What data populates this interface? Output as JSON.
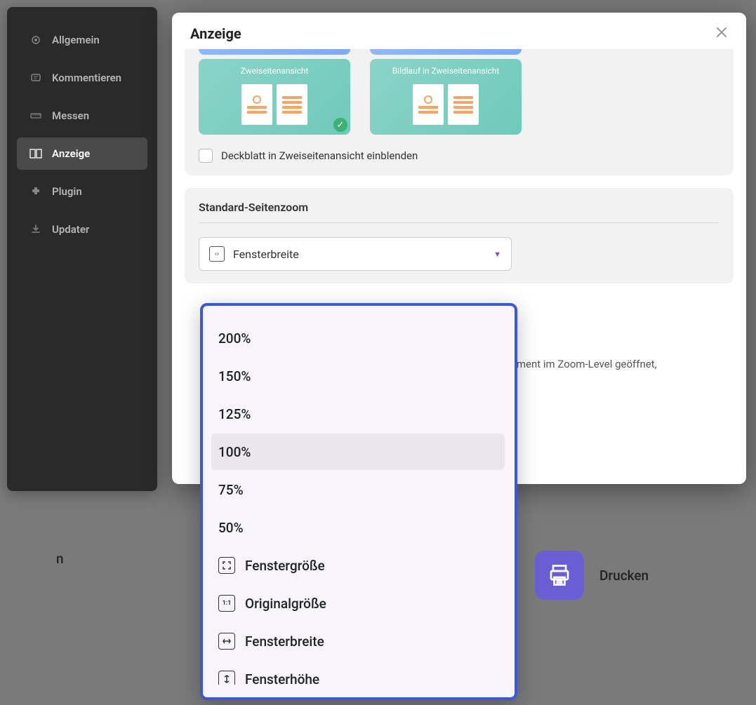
{
  "sidebar": {
    "items": [
      {
        "label": "Allgemein"
      },
      {
        "label": "Kommentieren"
      },
      {
        "label": "Messen"
      },
      {
        "label": "Anzeige"
      },
      {
        "label": "Plugin"
      },
      {
        "label": "Updater"
      }
    ]
  },
  "modal": {
    "title": "Anzeige"
  },
  "view_section": {
    "card1_label": "Zweiseitenansicht",
    "card2_label": "Bildlauf in Zweiseitenansicht",
    "cover_checkbox_label": "Deckblatt in Zweiseitenansicht einblenden"
  },
  "zoom_section": {
    "title": "Standard-Seitenzoom",
    "selected_label": "Fensterbreite",
    "note_partial": "kument im Zoom-Level geöffnet,"
  },
  "dropdown": {
    "items": [
      {
        "label": "200%"
      },
      {
        "label": "150%"
      },
      {
        "label": "125%"
      },
      {
        "label": "100%"
      },
      {
        "label": "75%"
      },
      {
        "label": "50%"
      },
      {
        "label": "Fenstergröße",
        "icon": "fit-size"
      },
      {
        "label": "Originalgröße",
        "icon": "original"
      },
      {
        "label": "Fensterbreite",
        "icon": "fit-width"
      },
      {
        "label": "Fensterhöhe",
        "icon": "fit-height"
      }
    ]
  },
  "bg_actions": {
    "left_label": "n",
    "right_label": "Drucken"
  }
}
